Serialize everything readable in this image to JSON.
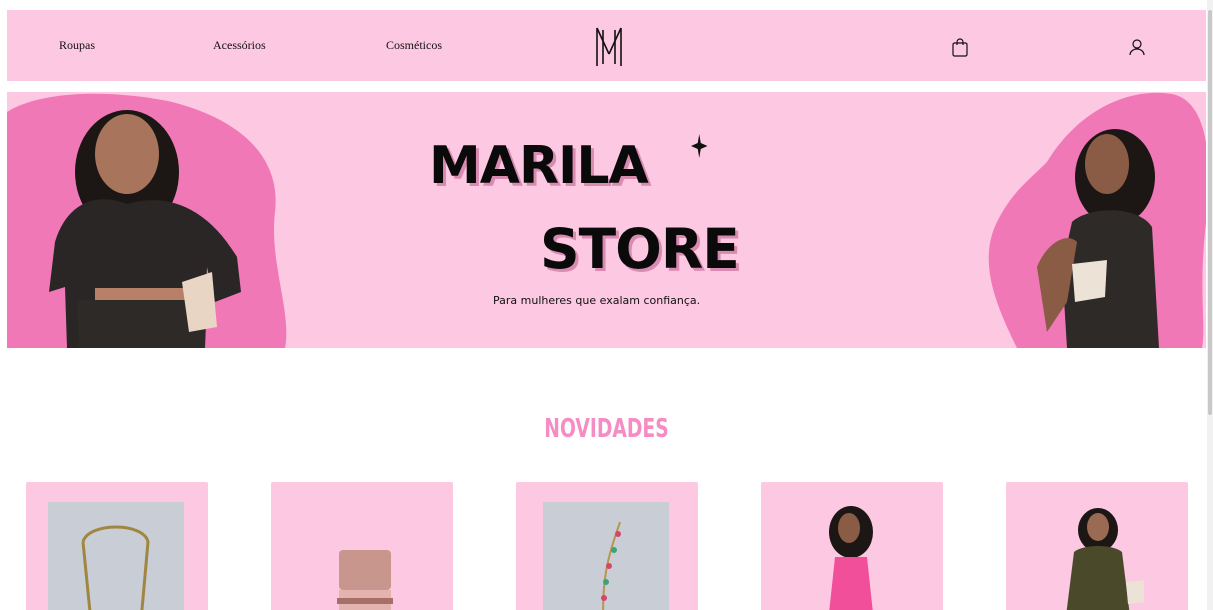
{
  "nav": {
    "links": [
      "Roupas",
      "Acessórios",
      "Cosméticos"
    ],
    "logo": "logo-M",
    "cart_icon": "shopping-bag-icon",
    "user_icon": "user-icon"
  },
  "hero": {
    "title_line1": "MARILA",
    "title_line2": "STORE",
    "tagline": "Para mulheres que exalam confiança."
  },
  "section": {
    "title": "NOVIDADES"
  },
  "products": [
    {
      "image": "gold-necklace-photo"
    },
    {
      "image": "rose-perfume-bottle-photo"
    },
    {
      "image": "beaded-bracelet-photo"
    },
    {
      "image": "pink-dress-model-photo"
    },
    {
      "image": "olive-dress-model-photo"
    }
  ],
  "colors": {
    "brand_pink": "#fdc8e2",
    "accent_pink": "#f58cc4",
    "hero_blob": "#f178b6"
  }
}
